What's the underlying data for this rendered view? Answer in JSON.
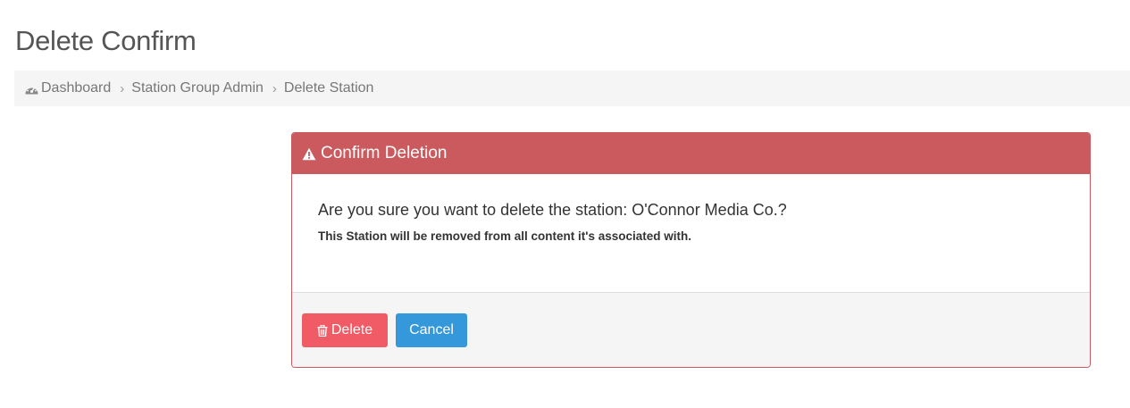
{
  "page": {
    "title": "Delete Confirm"
  },
  "breadcrumb": {
    "items": [
      {
        "label": "Dashboard",
        "icon": "dashboard-icon"
      },
      {
        "label": "Station Group Admin"
      },
      {
        "label": "Delete Station"
      }
    ],
    "separator": "›"
  },
  "panel": {
    "heading": "Confirm Deletion",
    "heading_icon": "warning-icon",
    "question": "Are you sure you want to delete the station: O'Connor Media Co.?",
    "note": "This Station will be removed from all content it's associated with.",
    "delete_label": "Delete",
    "delete_icon": "trash-icon",
    "cancel_label": "Cancel"
  },
  "colors": {
    "danger_header": "#cb5a5e",
    "delete_button": "#f05b65",
    "cancel_button": "#3498db",
    "breadcrumb_bg": "#f5f5f5"
  }
}
